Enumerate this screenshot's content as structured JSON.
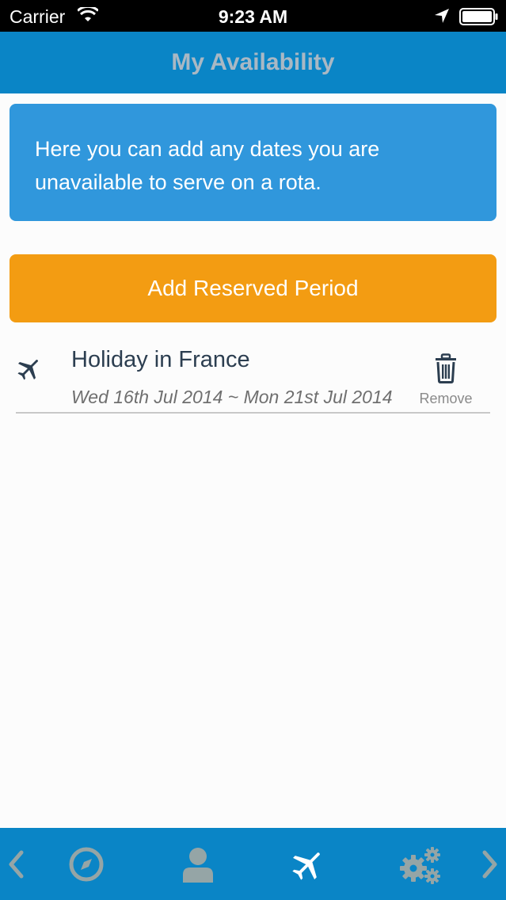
{
  "status_bar": {
    "carrier": "Carrier",
    "time": "9:23 AM",
    "icons": [
      "wifi-icon",
      "location-arrow-icon",
      "battery-icon"
    ]
  },
  "nav": {
    "title": "My Availability"
  },
  "info": {
    "text": "Here you can add any dates you are unavailable to serve on a rota."
  },
  "actions": {
    "add_label": "Add Reserved Period"
  },
  "reserved_periods": [
    {
      "icon": "airplane-icon",
      "title": "Holiday in France",
      "dates": "Wed 16th Jul 2014 ~ Mon 21st Jul 2014",
      "remove_label": "Remove"
    }
  ],
  "tab_bar": {
    "items": [
      "back-arrow-icon",
      "compass-icon",
      "person-icon",
      "airplane-icon",
      "gears-icon",
      "forward-arrow-icon"
    ],
    "active": "airplane-icon"
  },
  "colors": {
    "nav_blue": "#0a85c6",
    "info_blue": "#3097dc",
    "accent_orange": "#f39c12",
    "title_text": "#a9b8c4"
  }
}
